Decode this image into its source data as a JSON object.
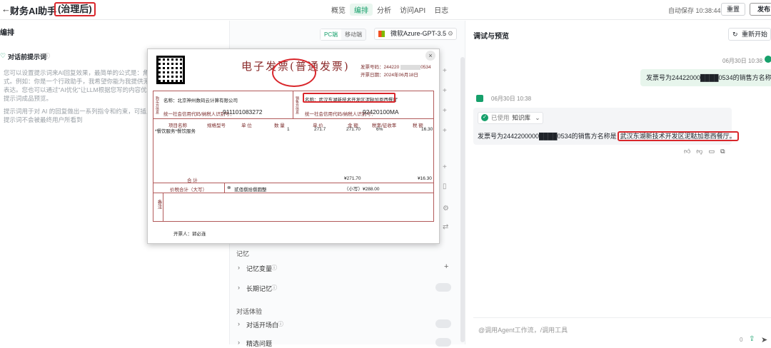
{
  "header": {
    "back_icon": "←",
    "title": "财务AI助手",
    "subtitle": "(治理后)",
    "tabs": [
      "概览",
      "编排",
      "分析",
      "访问API",
      "日志"
    ],
    "active_tab": "编排",
    "autosave": "自动保存 10:38:44",
    "reset_label": "重置",
    "publish_label": "发布"
  },
  "left": {
    "header": "编排",
    "section_title": "对话前提示词",
    "section_icon": "heart-icon",
    "prompt_paragraphs": [
      "您可以设置提示词来AI回复效果，最简单的公式是：角\n式。例如：你是一个行政助手，我希望你能为我提供无\n表达。您也可以通过\"AI优化\"让LLM根据您写的内容优化\n提示词成品预览。",
      "提示词用于对 AI 的回复做出一系列指令和约束，可插入\n提示词不会被最终用户所看到"
    ]
  },
  "mid": {
    "view_tabs": [
      "PC端",
      "移动端"
    ],
    "active_view": "PC端",
    "model": "微软Azure-GPT-3.5",
    "memory_group": "记忆",
    "memory_var": "记忆变量",
    "long_memory": "长期记忆",
    "chat_group": "对话体验",
    "chat_opening": "对话开场白",
    "more_item": "精选问题"
  },
  "right": {
    "header": "调试与预览",
    "restart_label": "重新开始",
    "user_time": "06月30日 10:38",
    "user_message": "发票号为24422000████0534的销售方名称",
    "bot_time": "06月30日 10:38",
    "kb_used": "已使用",
    "kb_name": "知识库",
    "bot_text_prefix": "发票号为2442200000████0534的销售方名称是",
    "bot_text_highlight": "武汉东湖新技术开发区泥鞑加恩西餐厅。",
    "composer_placeholder": "@调用Agent工作流，/调用工具",
    "composer_count": "0"
  },
  "invoice": {
    "title": "电子发票(普通发票)",
    "number_label": "发票号码：244220",
    "number_tail": "0534",
    "date_label": "开票日期：2024年06月18日",
    "buyer_label": "购买方信息",
    "buyer_name": "名称：北京神州数码云计算有限公司",
    "buyer_tax": "统一社会信用代码/纳税人识别号：",
    "buyer_tax_val": "911101083272",
    "seller_label": "销售方信息",
    "seller_name": "名称：武汉东湖新技术开发区泥鞑加恩西餐厅",
    "seller_tax": "统一社会信用代码/纳税人识别号：",
    "seller_tax_val": "92420100MA",
    "col_item": "项目名称",
    "col_spec": "规格型号",
    "col_unit": "单 位",
    "col_qty": "数 量",
    "col_price": "单 价",
    "col_amount": "金 额",
    "col_rate": "税率/征收率",
    "col_tax": "税 额",
    "item_name": "*餐饮服务*餐饮服务",
    "item_qty": "1",
    "item_price": "271.7",
    "item_amount": "271.70",
    "item_rate": "6%",
    "item_tax": "16.30",
    "total_label": "合    计",
    "total_amount": "¥271.70",
    "total_tax": "¥16.30",
    "sum_label": "价税合计（大写）",
    "sum_upper": "贰佰捌拾捌圆整",
    "sum_lower": "（小写）¥288.00",
    "remark_label": "备注",
    "issuer": "开票人：郭必连",
    "close_icon": "×"
  }
}
